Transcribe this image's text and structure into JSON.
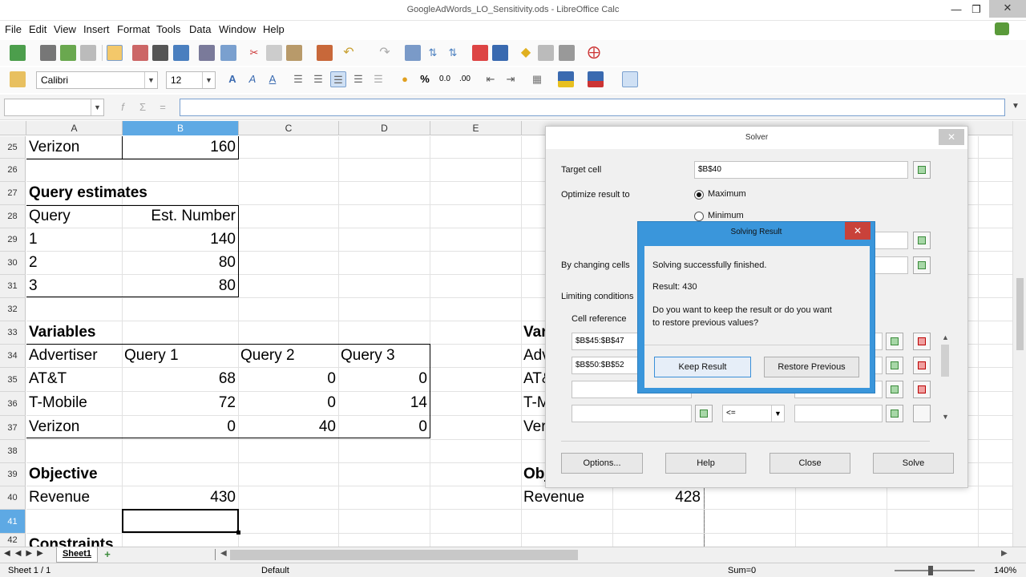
{
  "window": {
    "title": "GoogleAdWords_LO_Sensitivity.ods - LibreOffice Calc"
  },
  "menu": [
    "File",
    "Edit",
    "View",
    "Insert",
    "Format",
    "Tools",
    "Data",
    "Window",
    "Help"
  ],
  "format_bar": {
    "font_name": "Calibri",
    "font_size": "12"
  },
  "formula_bar": {
    "name_box": "",
    "formula": ""
  },
  "columns": [
    "A",
    "B",
    "C",
    "D",
    "E"
  ],
  "rows": [
    {
      "num": "25",
      "a": "Verizon",
      "b": "160"
    },
    {
      "num": "26"
    },
    {
      "num": "27",
      "a": "Query estimates"
    },
    {
      "num": "28",
      "a": "Query",
      "b": "Est. Number"
    },
    {
      "num": "29",
      "a": "1",
      "b": "140"
    },
    {
      "num": "30",
      "a": "2",
      "b": "80"
    },
    {
      "num": "31",
      "a": "3",
      "b": "80"
    },
    {
      "num": "32"
    },
    {
      "num": "33",
      "a": "Variables",
      "f": "Vari"
    },
    {
      "num": "34",
      "a": "Advertiser",
      "b": "Query 1",
      "c": "Query 2",
      "d": "Query 3",
      "f": "Adv"
    },
    {
      "num": "35",
      "a": "AT&T",
      "b": "68",
      "c": "0",
      "d": "0",
      "f": "AT&"
    },
    {
      "num": "36",
      "a": "T-Mobile",
      "b": "72",
      "c": "0",
      "d": "14",
      "f": "T-M"
    },
    {
      "num": "37",
      "a": "Verizon",
      "b": "0",
      "c": "40",
      "d": "0",
      "f": "Ver"
    },
    {
      "num": "38"
    },
    {
      "num": "39",
      "a": "Objective",
      "f": "Obj"
    },
    {
      "num": "40",
      "a": "Revenue",
      "b": "430",
      "f": "Revenue",
      "g": "428"
    },
    {
      "num": "41"
    },
    {
      "num": "42",
      "a": "Constraints"
    }
  ],
  "solver": {
    "title": "Solver",
    "target_label": "Target cell",
    "target_value": "$B$40",
    "optimize_label": "Optimize result to",
    "maximum": "Maximum",
    "minimum": "Minimum",
    "changing_label": "By changing cells",
    "limiting_label": "Limiting conditions",
    "cellref_label": "Cell reference",
    "cond1": "$B$45:$B$47",
    "cond2": "$B$50:$B$52",
    "op4": "<=",
    "options": "Options...",
    "help": "Help",
    "close": "Close",
    "solve": "Solve"
  },
  "result_dialog": {
    "title": "Solving Result",
    "line1": "Solving successfully finished.",
    "line2": "Result: 430",
    "line3": "Do you want to keep the result or do you want",
    "line4": "to restore previous values?",
    "keep": "Keep Result",
    "restore": "Restore Previous"
  },
  "sheets": [
    "Sheet1"
  ],
  "status": {
    "sheet": "Sheet 1 / 1",
    "style": "Default",
    "sum": "Sum=0",
    "zoom": "140%"
  }
}
